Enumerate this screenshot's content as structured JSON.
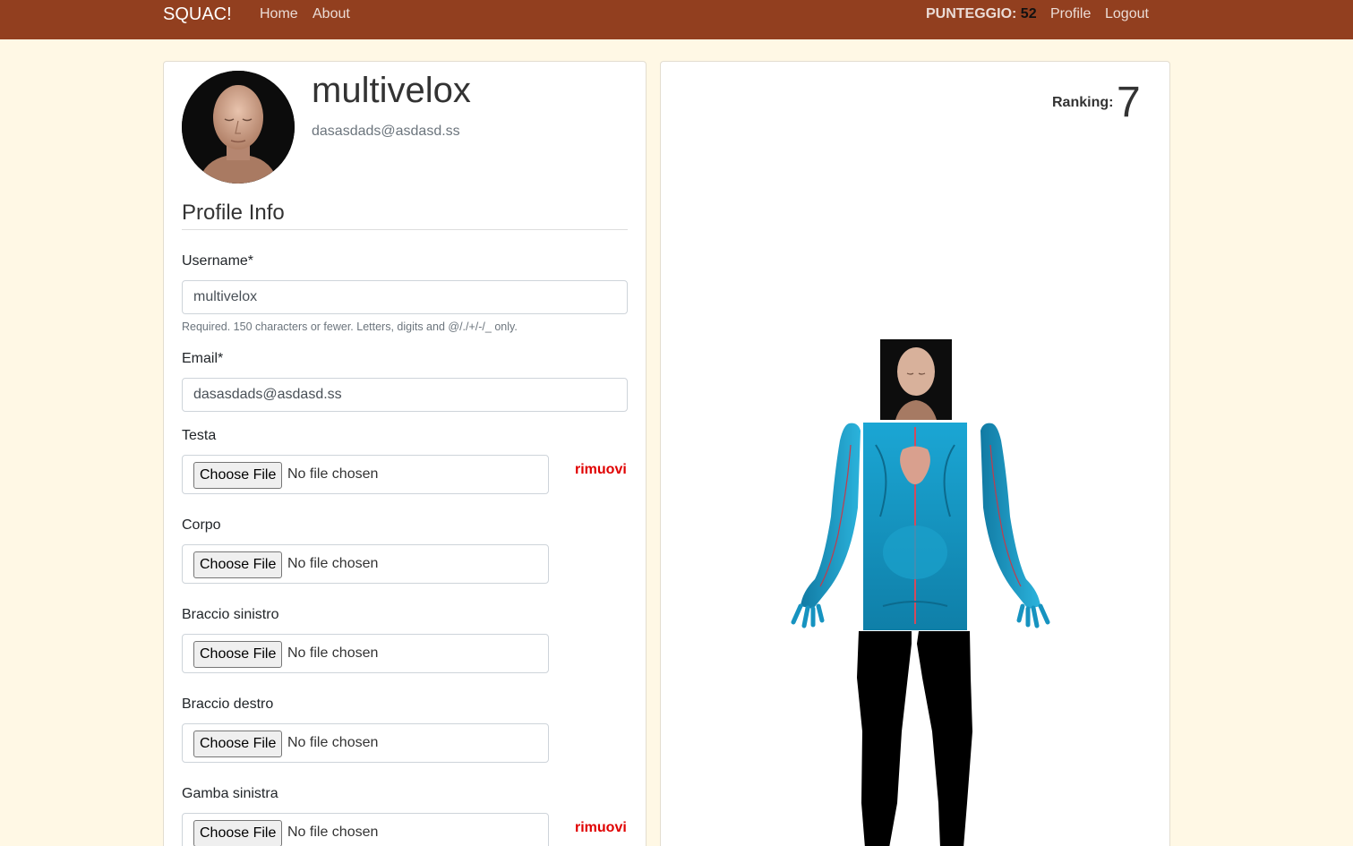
{
  "navbar": {
    "brand": "SQUAC!",
    "links": [
      "Home",
      "About"
    ],
    "score_label": "PUNTEGGIO:",
    "score_value": "52",
    "right_links": [
      "Profile",
      "Logout"
    ],
    "bg_color": "#923f1f"
  },
  "profile": {
    "username": "multivelox",
    "email": "dasasdads@asdasd.ss",
    "section_title": "Profile Info",
    "avatar_icon": "avatar-face"
  },
  "form": {
    "username_label": "Username*",
    "username_value": "multivelox",
    "username_help": "Required. 150 characters or fewer. Letters, digits and @/./+/-/_ only.",
    "email_label": "Email*",
    "email_value": "dasasdads@asdasd.ss",
    "file_fields": [
      {
        "label": "Testa",
        "button": "Choose File",
        "status": "No file chosen",
        "remove": "rimuovi"
      },
      {
        "label": "Corpo",
        "button": "Choose File",
        "status": "No file chosen"
      },
      {
        "label": "Braccio sinistro",
        "button": "Choose File",
        "status": "No file chosen"
      },
      {
        "label": "Braccio destro",
        "button": "Choose File",
        "status": "No file chosen"
      },
      {
        "label": "Gamba sinistra",
        "button": "Choose File",
        "status": "No file chosen",
        "remove": "rimuovi"
      }
    ]
  },
  "ranking": {
    "label": "Ranking:",
    "value": "7"
  },
  "colors": {
    "page_bg": "#fff8e5",
    "accent": "#923f1f",
    "remove_link": "#e00000"
  }
}
